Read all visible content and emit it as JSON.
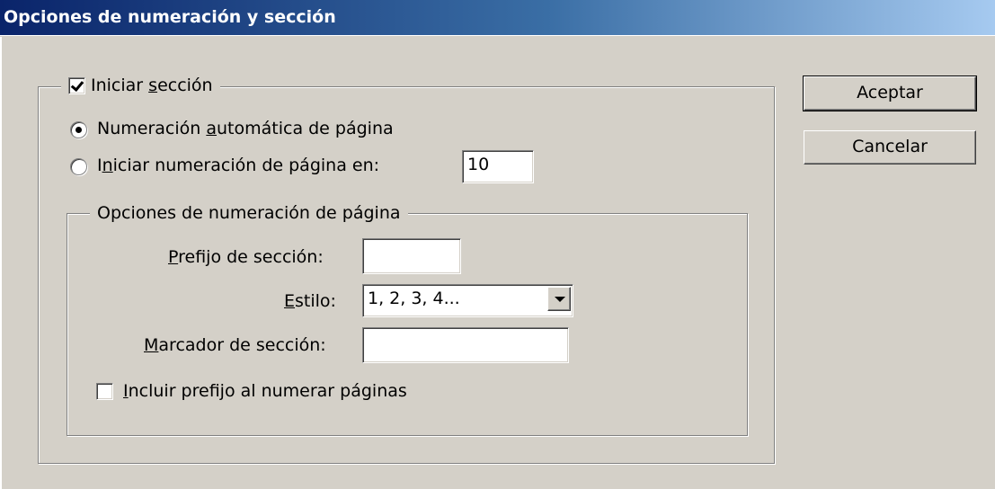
{
  "window": {
    "title": "Opciones de numeración y sección"
  },
  "section": {
    "start_section": {
      "label_pre": "Iniciar ",
      "label_key": "s",
      "label_post": "ección",
      "checked": true
    },
    "auto_numbering": {
      "label_pre": "Numeración ",
      "label_key": "a",
      "label_post": "utomática de página",
      "selected": true
    },
    "start_numbering": {
      "label_pre": "I",
      "label_key": "n",
      "label_post": "iciar numeración de página en:",
      "selected": false,
      "value": "10"
    }
  },
  "numbering_options": {
    "legend": "Opciones de numeración de página",
    "prefix": {
      "label_key": "P",
      "label_post": "refijo de sección:",
      "value": ""
    },
    "style": {
      "label_key": "E",
      "label_post": "stilo:",
      "value": "1, 2, 3, 4..."
    },
    "marker": {
      "label_key": "M",
      "label_post": "arcador de sección:",
      "value": ""
    },
    "include_prefix": {
      "label_key": "I",
      "label_post": "ncluir prefijo al numerar páginas",
      "checked": false
    }
  },
  "buttons": {
    "ok": "Aceptar",
    "cancel": "Cancelar"
  },
  "colors": {
    "face": "#d4d0c8",
    "title_start": "#0a246a",
    "title_end": "#a6caf0"
  }
}
